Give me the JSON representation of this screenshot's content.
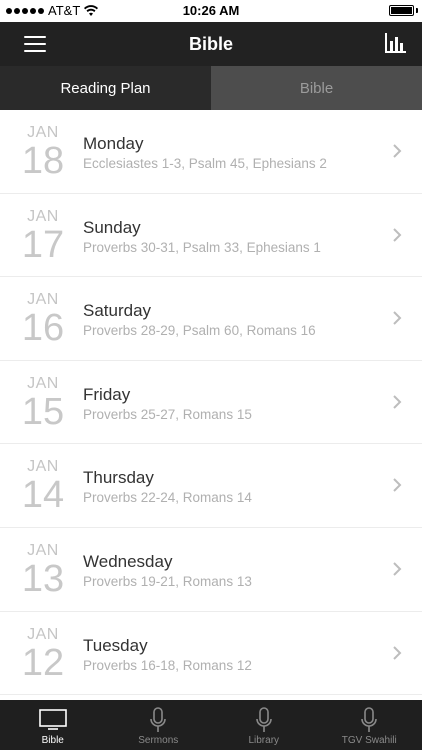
{
  "status_bar": {
    "carrier": "AT&T",
    "time": "10:26 AM"
  },
  "nav": {
    "title": "Bible",
    "left_icon": "menu-icon",
    "right_icon": "bar-chart-icon"
  },
  "segments": [
    {
      "label": "Reading Plan",
      "active": true
    },
    {
      "label": "Bible",
      "active": false
    }
  ],
  "readings": [
    {
      "month": "JAN",
      "day": "18",
      "weekday": "Monday",
      "passages": "Ecclesiastes 1-3, Psalm 45, Ephesians 2"
    },
    {
      "month": "JAN",
      "day": "17",
      "weekday": "Sunday",
      "passages": "Proverbs 30-31, Psalm 33, Ephesians 1"
    },
    {
      "month": "JAN",
      "day": "16",
      "weekday": "Saturday",
      "passages": "Proverbs 28-29, Psalm 60, Romans 16"
    },
    {
      "month": "JAN",
      "day": "15",
      "weekday": "Friday",
      "passages": "Proverbs 25-27, Romans 15"
    },
    {
      "month": "JAN",
      "day": "14",
      "weekday": "Thursday",
      "passages": "Proverbs 22-24, Romans 14"
    },
    {
      "month": "JAN",
      "day": "13",
      "weekday": "Wednesday",
      "passages": "Proverbs 19-21, Romans 13"
    },
    {
      "month": "JAN",
      "day": "12",
      "weekday": "Tuesday",
      "passages": "Proverbs 16-18, Romans 12"
    }
  ],
  "tabs": [
    {
      "label": "Bible",
      "icon": "tv-icon",
      "active": true
    },
    {
      "label": "Sermons",
      "icon": "microphone-icon",
      "active": false
    },
    {
      "label": "Library",
      "icon": "microphone-icon",
      "active": false
    },
    {
      "label": "TGV Swahili",
      "icon": "microphone-icon",
      "active": false
    }
  ],
  "colors": {
    "nav_background": "#222222",
    "tab_background": "#1f1f1f",
    "active_segment": "#2a2a2a",
    "inactive_segment": "#4d4d4d"
  }
}
